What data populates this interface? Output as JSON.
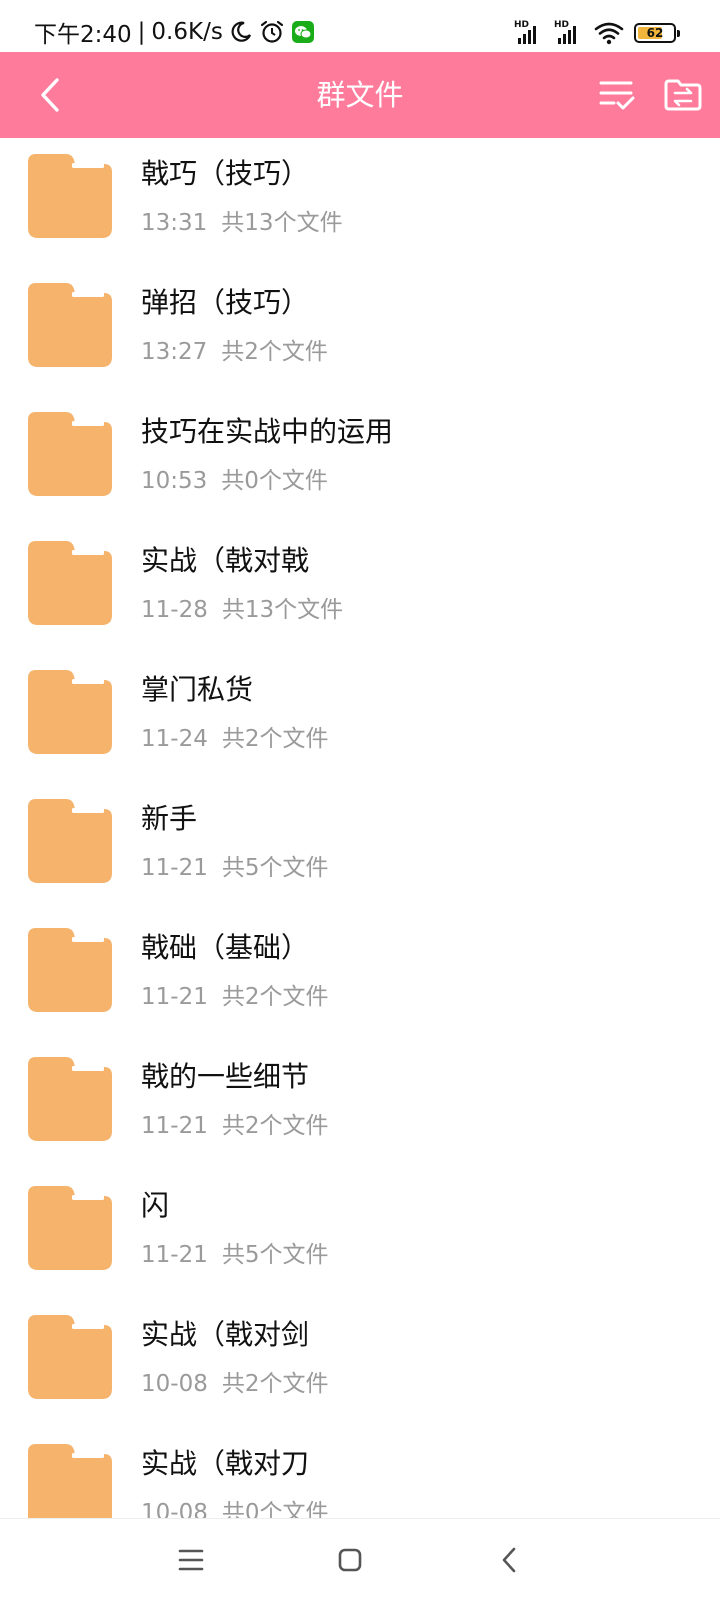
{
  "status_bar": {
    "time": "下午2:40",
    "separator": "|",
    "network_speed": "0.6K/s",
    "signal_label_1": "HD",
    "signal_label_2": "HD",
    "battery_percent": "62",
    "icons": [
      "moon-icon",
      "alarm-icon",
      "wechat-icon",
      "signal-icon",
      "wifi-icon",
      "battery-icon"
    ]
  },
  "header": {
    "title": "群文件",
    "background_color": "#ff7b9c"
  },
  "files": [
    {
      "name": "戟巧（技巧）",
      "date": "13:31",
      "count": "共13个文件"
    },
    {
      "name": "弹招（技巧）",
      "date": "13:27",
      "count": "共2个文件"
    },
    {
      "name": "技巧在实战中的运用",
      "date": "10:53",
      "count": "共0个文件"
    },
    {
      "name": "实战（戟对戟",
      "date": "11-28",
      "count": "共13个文件"
    },
    {
      "name": "掌门私货",
      "date": "11-24",
      "count": "共2个文件"
    },
    {
      "name": "新手",
      "date": "11-21",
      "count": "共5个文件"
    },
    {
      "name": "戟础（基础）",
      "date": "11-21",
      "count": "共2个文件"
    },
    {
      "name": "戟的一些细节",
      "date": "11-21",
      "count": "共2个文件"
    },
    {
      "name": "闪",
      "date": "11-21",
      "count": "共5个文件"
    },
    {
      "name": "实战（戟对剑",
      "date": "10-08",
      "count": "共2个文件"
    },
    {
      "name": "实战（戟对刀",
      "date": "10-08",
      "count": "共0个文件"
    }
  ],
  "colors": {
    "folder": "#f5b36b",
    "folder_tab": "#ffffff",
    "meta_text": "#9a9a9a"
  },
  "nav_bar": {
    "icons": [
      "menu-icon",
      "home-icon",
      "back-icon"
    ]
  }
}
